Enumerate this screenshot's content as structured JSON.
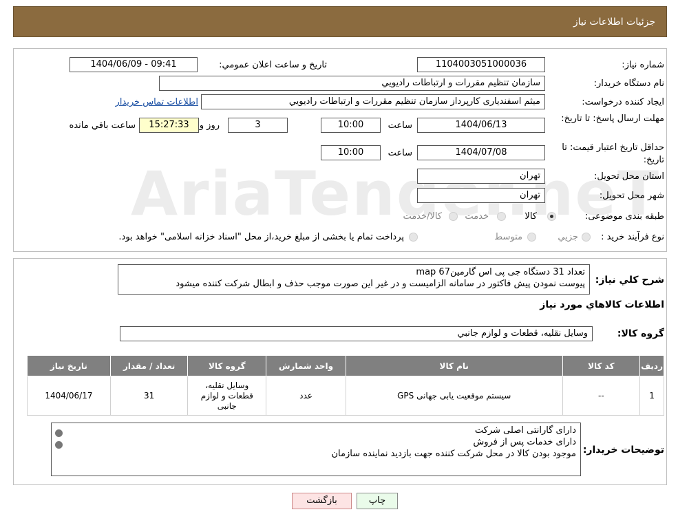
{
  "header": {
    "title": "جزئیات اطلاعات نیاز"
  },
  "watermark": "AriaTender.neT",
  "fields": {
    "need_number_label": "شماره نیاز:",
    "need_number": "1104003051000036",
    "announce_label": "تاریخ و ساعت اعلان عمومي:",
    "announce_value": "1404/06/09 - 09:41",
    "buyer_org_label": "نام دستگاه خريدار:",
    "buyer_org": "سازمان تنظيم مقررات و ارتباطات راديويي",
    "creator_label": "ايجاد کننده درخواست:",
    "creator": "میثم اسفندیاری کارپرداز سازمان تنظيم مقررات و ارتباطات راديويي",
    "contact_link": "اطلاعات تماس خریدار",
    "deadline_label": "مهلت ارسال پاسخ: تا تاريخ:",
    "deadline_date": "1404/06/13",
    "time_label": "ساعت",
    "deadline_time": "10:00",
    "days_value": "3",
    "days_label": "روز و",
    "remaining_time": "15:27:33",
    "remaining_label": "ساعت باقي مانده",
    "validity_label": "حداقل تاريخ اعتبار قيمت: تا تاريخ:",
    "validity_date": "1404/07/08",
    "validity_time": "10:00",
    "province_label": "استان محل تحويل:",
    "province": "تهران",
    "city_label": "شهر محل تحويل:",
    "city": "تهران",
    "category_label": "طبقه بندی موضوعی:",
    "category_options": [
      "کالا",
      "خدمت",
      "کالا/خدمت"
    ],
    "process_label": "نوع فرآيند خريد :",
    "process_options": [
      "جزيي",
      "متوسط"
    ],
    "process_note": "پرداخت تمام یا بخشی از مبلغ خرید،از محل \"اسناد خزانه اسلامی\" خواهد بود."
  },
  "summary": {
    "label": "شرح کلي نياز:",
    "line1": "تعداد 31 دستگاه جی پی اس گارمینmap 67",
    "line2": "پیوست نمودن پیش فاکتور در  سامانه الزامیست و در غیر این صورت موجب حذف و ابطال شرکت کننده میشود"
  },
  "goods_info_title": "اطلاعات کالاهاي مورد نياز",
  "goods_group": {
    "label": "گروه کالا:",
    "value": "وسايل نقليه، قطعات و لوازم جانبي"
  },
  "table": {
    "headers": [
      "رديف",
      "کد کالا",
      "نام کالا",
      "واحد شمارش",
      "گروه کالا",
      "تعداد / مقدار",
      "تاريخ نياز"
    ],
    "row": [
      "1",
      "--",
      "سیستم موقعیت یابی جهانی GPS",
      "عدد",
      "وسایل نقلیه، قطعات و لوازم جانبی",
      "31",
      "1404/06/17"
    ]
  },
  "buyer_notes": {
    "label": "توضيحات خريدار:",
    "lines": [
      "دارای گارانتی اصلی شرکت",
      "دارای خدمات پس از فروش",
      "موجود بودن کالا در محل شرکت کننده جهت بازدید نماینده سازمان"
    ]
  },
  "buttons": {
    "print": "چاپ",
    "back": "بازگشت"
  },
  "colors": {
    "header": "#8b6b3f",
    "table_header": "#808080",
    "time_bg": "#ffffcc",
    "link": "#1a4fa3"
  }
}
